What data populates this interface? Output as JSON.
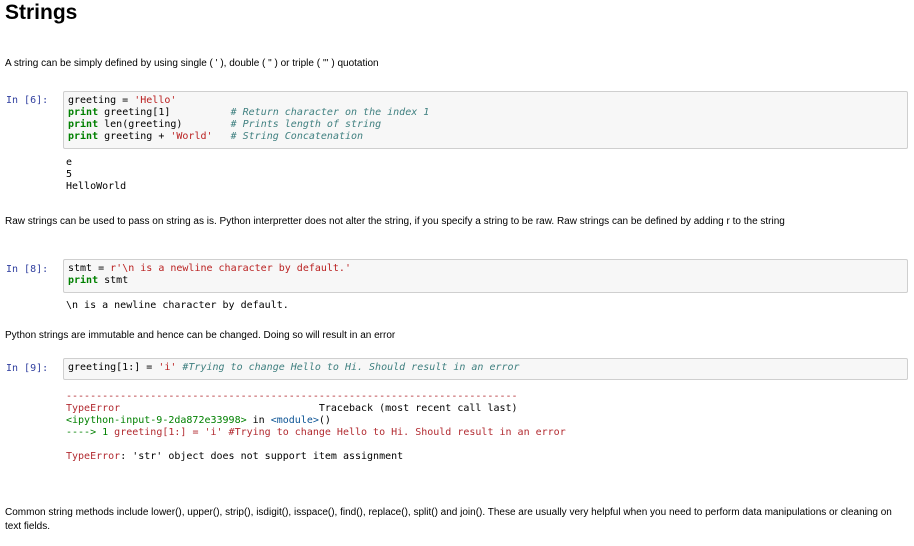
{
  "title": "Strings",
  "md1": "A string can be simply defined by using single ( ' ), double ( \" ) or triple ( ''' ) quotation",
  "md2": "Raw strings can be used to pass on string as is. Python interpretter does not alter the string, if you specify a string to be raw. Raw strings can be defined by adding r to the string",
  "md3": "Python strings are immutable and hence can be changed. Doing so will result in an error",
  "md4": "Common string methods include lower(), upper(), strip(), isdigit(), isspace(), find(), replace(), split() and join(). These are usually very helpful when you need to perform data manipulations or cleaning on text fields.",
  "cell1": {
    "prompt": "In [6]:",
    "lines": [
      {
        "a": "greeting = ",
        "b": "'Hello'",
        "c": "",
        "cm": ""
      },
      {
        "a": "print ",
        "b": "",
        "c": "greeting[1]",
        "cm": "# Return character on the index 1"
      },
      {
        "a": "print ",
        "b": "",
        "c": "len(greeting)",
        "cm": "# Prints length of string"
      },
      {
        "a": "print ",
        "b": "'World'",
        "c": "greeting + ",
        "cm": "# String Concatenation"
      }
    ],
    "output": [
      "e",
      "5",
      "HelloWorld"
    ]
  },
  "cell2": {
    "prompt": "In [8]:",
    "line1_a": "stmt = ",
    "line1_b": "r'\\n is a newline character by default.'",
    "line2_kw": "print",
    "line2_rest": " stmt",
    "output": "\\n is a newline character by default."
  },
  "cell3": {
    "prompt": "In [9]:",
    "code_a": "greeting[1:] = ",
    "code_b": "'i'",
    "code_cm": " #Trying to change Hello to Hi. Should result in an error",
    "err_rule": "---------------------------------------------------------------------------",
    "err_name": "TypeError",
    "err_tb": "Traceback (most recent call last)",
    "err_input": "<ipython-input-9-2da872e33998>",
    "err_in": " in ",
    "err_module": "<module>",
    "err_paren": "()",
    "err_arrow": "----> 1 ",
    "err_line": "greeting[1:] = 'i' #Trying to change Hello to Hi. Should result in an error",
    "err_final_name": "TypeError",
    "err_final_msg": ": 'str' object does not support item assignment"
  }
}
